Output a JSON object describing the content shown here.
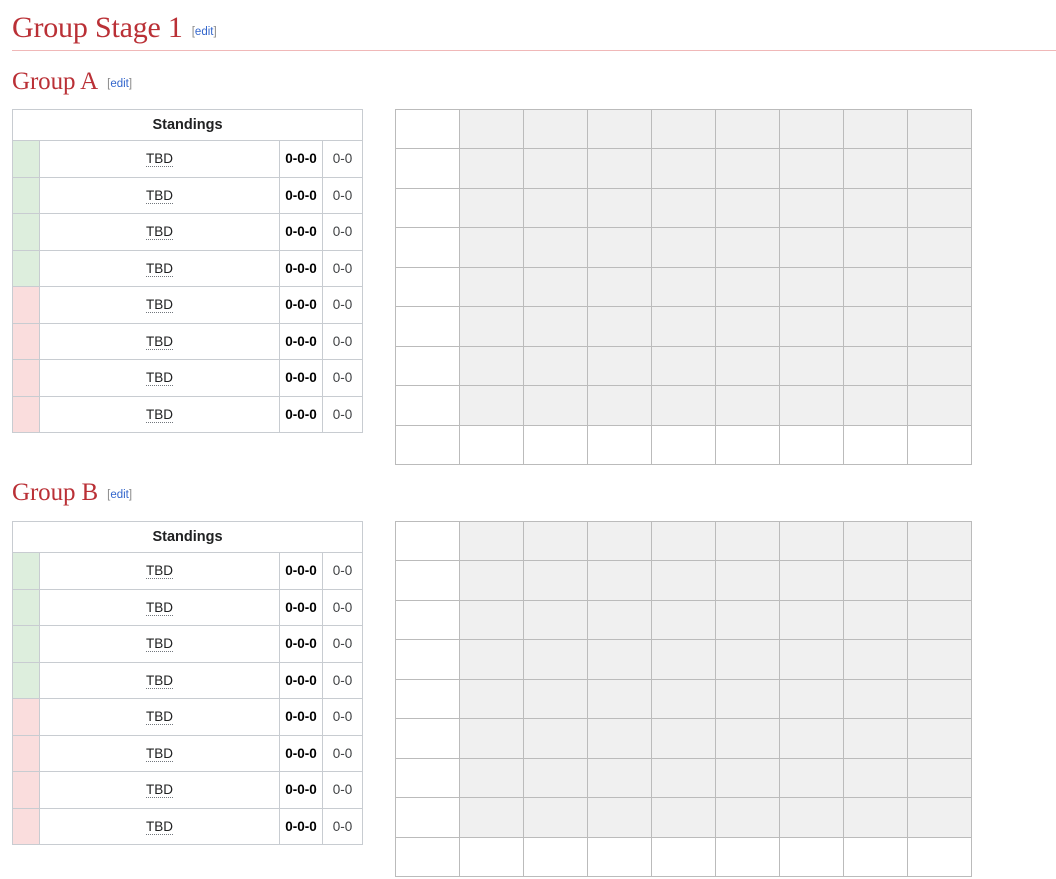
{
  "page": {
    "stage_heading": "Group Stage 1",
    "edit_label": "[edit]",
    "edit_open": "[",
    "edit_text": "edit",
    "edit_close": "]"
  },
  "colors": {
    "heading": "#ba3036",
    "heading_rule": "#f0b8b8",
    "edit_link": "#3366cc",
    "advance_stripe": "#ddeedd",
    "eliminate_stripe": "#fadddd",
    "table_border": "#c8ccd1",
    "grid_border": "#bbbbbb",
    "grid_cell": "#f0f0f0",
    "page_background": "#ffffff"
  },
  "groups": [
    {
      "heading": "Group A",
      "edit_label": "[edit]",
      "standings": {
        "header": "Standings",
        "rows": [
          {
            "stripe": "advance",
            "team": "TBD",
            "record": "0-0-0",
            "score": "0-0"
          },
          {
            "stripe": "advance",
            "team": "TBD",
            "record": "0-0-0",
            "score": "0-0"
          },
          {
            "stripe": "advance",
            "team": "TBD",
            "record": "0-0-0",
            "score": "0-0"
          },
          {
            "stripe": "advance",
            "team": "TBD",
            "record": "0-0-0",
            "score": "0-0"
          },
          {
            "stripe": "eliminate",
            "team": "TBD",
            "record": "0-0-0",
            "score": "0-0"
          },
          {
            "stripe": "eliminate",
            "team": "TBD",
            "record": "0-0-0",
            "score": "0-0"
          },
          {
            "stripe": "eliminate",
            "team": "TBD",
            "record": "0-0-0",
            "score": "0-0"
          },
          {
            "stripe": "eliminate",
            "team": "TBD",
            "record": "0-0-0",
            "score": "0-0"
          }
        ]
      },
      "crosstable": {
        "columns": 9,
        "body_rows": 8,
        "footer_rows": 1,
        "cells": []
      }
    },
    {
      "heading": "Group B",
      "edit_label": "[edit]",
      "standings": {
        "header": "Standings",
        "rows": [
          {
            "stripe": "advance",
            "team": "TBD",
            "record": "0-0-0",
            "score": "0-0"
          },
          {
            "stripe": "advance",
            "team": "TBD",
            "record": "0-0-0",
            "score": "0-0"
          },
          {
            "stripe": "advance",
            "team": "TBD",
            "record": "0-0-0",
            "score": "0-0"
          },
          {
            "stripe": "advance",
            "team": "TBD",
            "record": "0-0-0",
            "score": "0-0"
          },
          {
            "stripe": "eliminate",
            "team": "TBD",
            "record": "0-0-0",
            "score": "0-0"
          },
          {
            "stripe": "eliminate",
            "team": "TBD",
            "record": "0-0-0",
            "score": "0-0"
          },
          {
            "stripe": "eliminate",
            "team": "TBD",
            "record": "0-0-0",
            "score": "0-0"
          },
          {
            "stripe": "eliminate",
            "team": "TBD",
            "record": "0-0-0",
            "score": "0-0"
          }
        ]
      },
      "crosstable": {
        "columns": 9,
        "body_rows": 8,
        "footer_rows": 1,
        "cells": []
      }
    }
  ]
}
